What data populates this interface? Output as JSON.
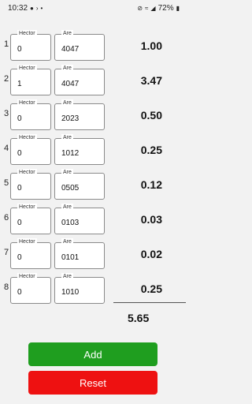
{
  "status_bar": {
    "time": "10:32",
    "battery": "72%",
    "icons": [
      "chat-icon",
      "media-icon",
      "dot-icon",
      "silent-icon",
      "wifi-icon",
      "signal-icon",
      "battery-icon"
    ]
  },
  "labels": {
    "hector": "Hector",
    "are": "Are"
  },
  "rows": [
    {
      "num": "1",
      "hector": "0",
      "are": "4047",
      "result": "1.00"
    },
    {
      "num": "2",
      "hector": "1",
      "are": "4047",
      "result": "3.47"
    },
    {
      "num": "3",
      "hector": "0",
      "are": "2023",
      "result": "0.50"
    },
    {
      "num": "4",
      "hector": "0",
      "are": "1012",
      "result": "0.25"
    },
    {
      "num": "5",
      "hector": "0",
      "are": "0505",
      "result": "0.12"
    },
    {
      "num": "6",
      "hector": "0",
      "are": "0103",
      "result": "0.03"
    },
    {
      "num": "7",
      "hector": "0",
      "are": "0101",
      "result": "0.02"
    },
    {
      "num": "8",
      "hector": "0",
      "are": "1010",
      "result": "0.25"
    }
  ],
  "total": "5.65",
  "buttons": {
    "add": "Add",
    "reset": "Reset"
  },
  "colors": {
    "add": "#1f9e1f",
    "reset": "#ee1111",
    "background": "#f2f2f2"
  }
}
